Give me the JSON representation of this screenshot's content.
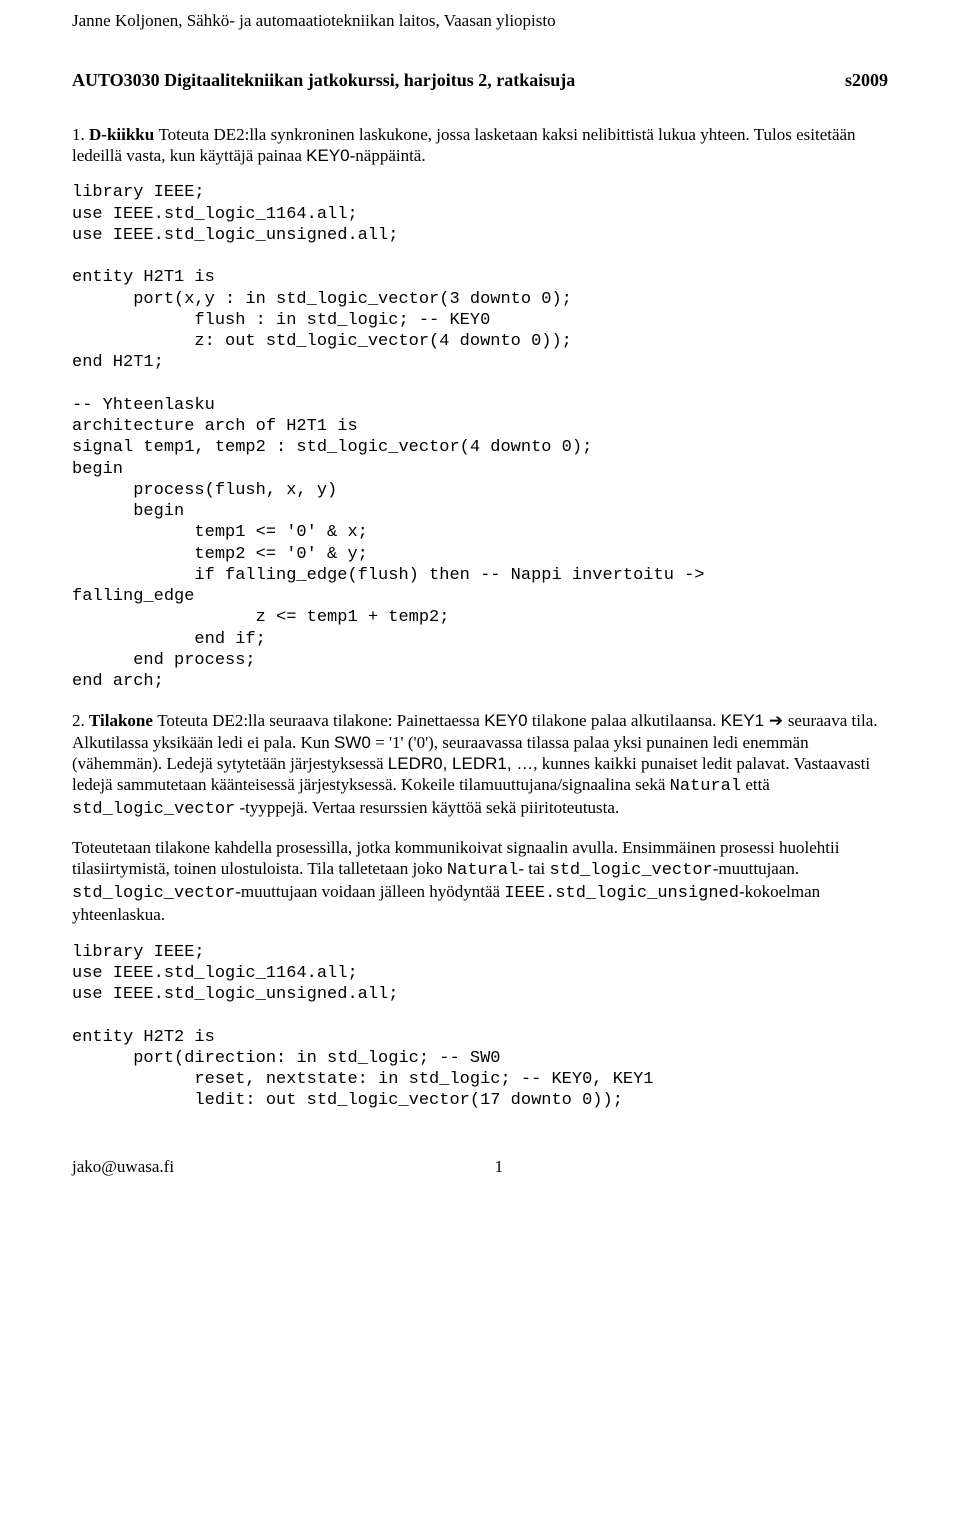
{
  "header": "Janne Koljonen, Sähkö- ja automaatiotekniikan laitos, Vaasan yliopisto",
  "title": "AUTO3030 Digitaalitekniikan jatkokurssi, harjoitus 2, ratkaisuja",
  "term": "s2009",
  "q1_num": "1.",
  "q1_lead": "D-kiikku ",
  "q1_body": "Toteuta DE2:lla synkroninen laskukone, jossa lasketaan kaksi nelibittistä lukua yhteen. Tulos esitetään ledeillä vasta, kun käyttäjä painaa ",
  "q1_key": "KEY0",
  "q1_tail": "-näppäintä.",
  "code1": "library IEEE;\nuse IEEE.std_logic_1164.all;\nuse IEEE.std_logic_unsigned.all;\n\nentity H2T1 is\n      port(x,y : in std_logic_vector(3 downto 0);\n            flush : in std_logic; -- KEY0\n            z: out std_logic_vector(4 downto 0));\nend H2T1;\n\n-- Yhteenlasku\narchitecture arch of H2T1 is\nsignal temp1, temp2 : std_logic_vector(4 downto 0);\nbegin\n      process(flush, x, y)\n      begin\n            temp1 <= '0' & x;\n            temp2 <= '0' & y;\n            if falling_edge(flush) then -- Nappi invertoitu ->\nfalling_edge\n                  z <= temp1 + temp2;\n            end if;\n      end process;\nend arch;",
  "q2_num": "2.",
  "q2_lead": "Tilakone ",
  "q2_a": "Toteuta DE2:lla seuraava tilakone: Painettaessa ",
  "q2_key0": "KEY0",
  "q2_b": " tilakone palaa alkutilaansa. ",
  "q2_key1": "KEY1",
  "q2_arrow": " ➔ ",
  "q2_c": "seuraava tila. Alkutilassa yksikään ledi ei pala. Kun ",
  "q2_sw0": "SW0",
  "q2_d": " = '1' ('0'), seuraavassa tilassa palaa yksi punainen ledi enemmän (vähemmän). Ledejä sytytetään järjestyksessä ",
  "q2_led": "LEDR0, LEDR1, …",
  "q2_e": ", kunnes kaikki punaiset ledit palavat. Vastaavasti ledejä sammutetaan käänteisessä järjestyksessä. Kokeile tilamuuttujana/signaalina sekä ",
  "q2_nat": "Natural",
  "q2_f": " että ",
  "q2_slv": "std_logic_vector",
  "q2_g": " -tyyppejä. Vertaa resurssien käyttöä sekä piiritoteutusta.",
  "p3_a": "Toteutetaan tilakone kahdella prosessilla, jotka kommunikoivat signaalin avulla. Ensimmäinen prosessi huolehtii tilasiirtymistä, toinen ulostuloista. Tila talletetaan joko ",
  "p3_nat": "Natural",
  "p3_b": "- tai ",
  "p3_slv1": "std_logic_vector",
  "p3_c": "-muuttujaan. ",
  "p3_slv2": "std_logic_vector",
  "p3_d": "-muuttujaan voidaan jälleen hyödyntää ",
  "p3_ieee": "IEEE.std_logic_unsigned",
  "p3_e": "-kokoelman yhteenlaskua.",
  "code2": "library IEEE;\nuse IEEE.std_logic_1164.all;\nuse IEEE.std_logic_unsigned.all;\n\nentity H2T2 is\n      port(direction: in std_logic; -- SW0\n            reset, nextstate: in std_logic; -- KEY0, KEY1\n            ledit: out std_logic_vector(17 downto 0));",
  "footer_email": "jako@uwasa.fi",
  "footer_page": "1"
}
